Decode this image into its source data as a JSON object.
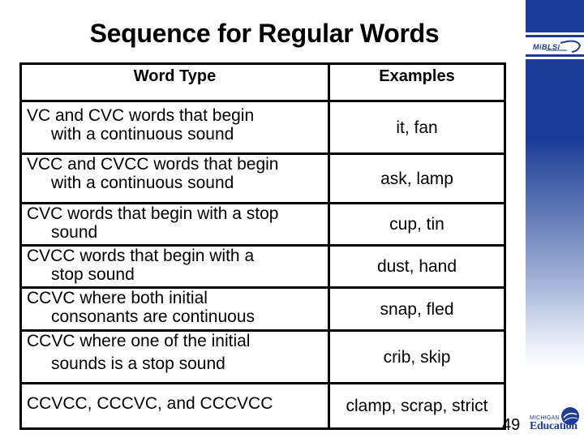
{
  "slide": {
    "title": "Sequence for Regular Words",
    "page_number": "49"
  },
  "branding": {
    "top_logo": "MiBLSi",
    "bottom_logo_small": "MICHIGAN",
    "bottom_logo_big": "Education",
    "accent_color": "#1E3C96"
  },
  "table": {
    "headers": [
      "Word Type",
      "Examples"
    ],
    "rows": [
      {
        "type_line1": "VC and CVC words that begin",
        "type_line2": "with a continuous sound",
        "examples": "it, fan"
      },
      {
        "type_line1": "VCC and CVCC words that begin",
        "type_line2": "with a continuous sound",
        "examples": "ask, lamp"
      },
      {
        "type_line1": "CVC words that begin with a stop",
        "type_line2": "sound",
        "examples": "cup, tin"
      },
      {
        "type_line1": "CVCC words that begin with a",
        "type_line2": "stop sound",
        "examples": "dust, hand"
      },
      {
        "type_line1": "CCVC where both initial",
        "type_line2": "consonants are continuous",
        "examples": "snap, fled"
      },
      {
        "type_line1": "CCVC where one of the initial",
        "type_line2": "sounds is a stop sound",
        "examples": "crib, skip"
      },
      {
        "type_line1": "CCVCC, CCCVC, and CCCVCC",
        "type_line2": "",
        "examples": "clamp, scrap, strict"
      }
    ]
  }
}
